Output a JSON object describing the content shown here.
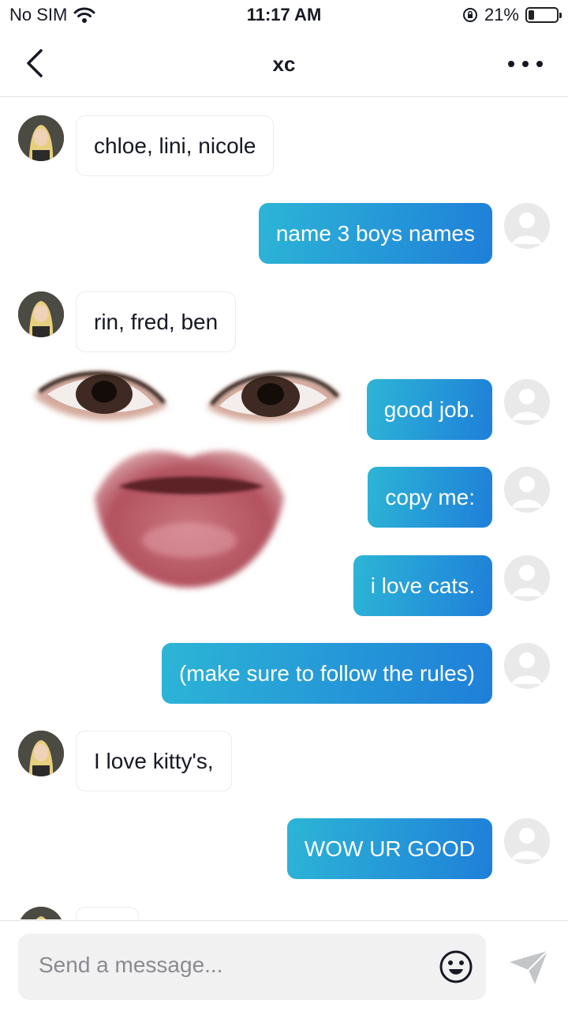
{
  "status_bar": {
    "carrier": "No SIM",
    "time": "11:17 AM",
    "battery": "21%",
    "battery_level": 0.21,
    "icons": [
      "wifi-icon",
      "orientation-lock-icon",
      "battery-icon"
    ]
  },
  "header": {
    "title": "xc",
    "back_icon": "chevron-left-icon",
    "more_icon": "more-horizontal-icon"
  },
  "messages": [
    {
      "from": "them",
      "text": "chloe, lini, nicole"
    },
    {
      "from": "me",
      "text": "name 3 boys names"
    },
    {
      "from": "them",
      "text": "rin, fred, ben"
    },
    {
      "from": "me",
      "text": "good job."
    },
    {
      "from": "me",
      "text": "copy me:"
    },
    {
      "from": "me",
      "text": "i love cats."
    },
    {
      "from": "me",
      "text": "(make sure to follow the rules)"
    },
    {
      "from": "them",
      "text": "I love kitty's,"
    },
    {
      "from": "me",
      "text": "WOW UR GOOD"
    }
  ],
  "composer": {
    "placeholder": "Send a message...",
    "emoji_icon": "emoji-icon",
    "send_icon": "send-icon"
  },
  "colors": {
    "bubble_out_start": "#2cb5d6",
    "bubble_out_end": "#1f7fd9",
    "text_primary": "#161823"
  }
}
